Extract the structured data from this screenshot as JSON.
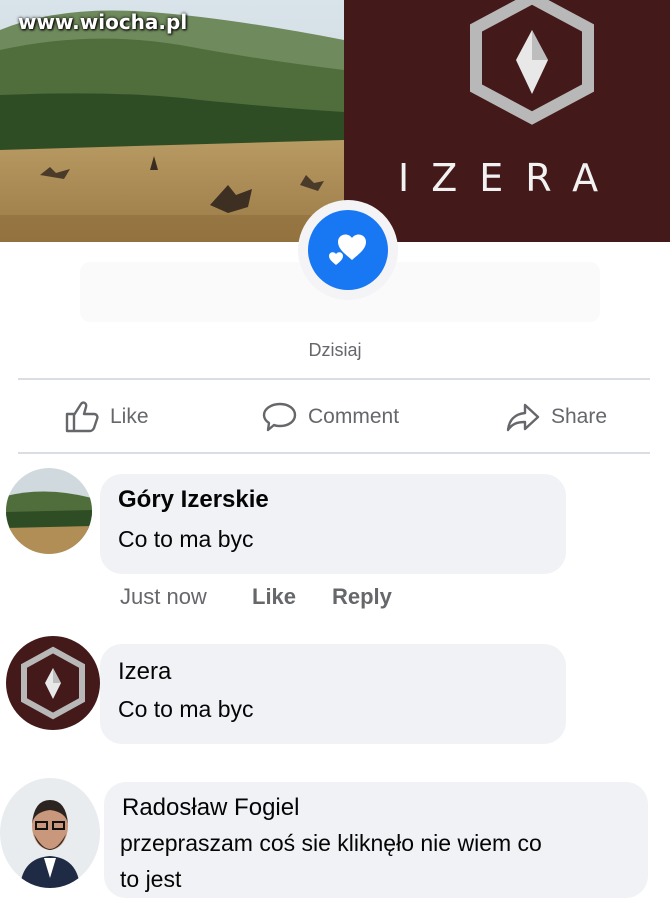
{
  "watermark": "www.wiocha.pl",
  "cover": {
    "brand_name": "IZERA",
    "brand_color": "#43191a"
  },
  "reaction_icon": "love-reaction-icon",
  "post": {
    "date_label": "Dzisiaj"
  },
  "actions": {
    "like": "Like",
    "comment": "Comment",
    "share": "Share"
  },
  "comments": [
    {
      "author": "Góry Izerskie",
      "text": "Co to ma byc",
      "time": "Just now",
      "like": "Like",
      "reply": "Reply"
    },
    {
      "author": "Izera",
      "text": "Co to ma byc"
    },
    {
      "author": "Radosław Fogiel",
      "text_line1": "przepraszam coś sie kliknęło nie wiem co",
      "text_line2": "to jest"
    }
  ],
  "colors": {
    "accent_blue": "#1877f2",
    "bubble_bg": "#f0f2f5",
    "secondary_text": "#65676b"
  }
}
